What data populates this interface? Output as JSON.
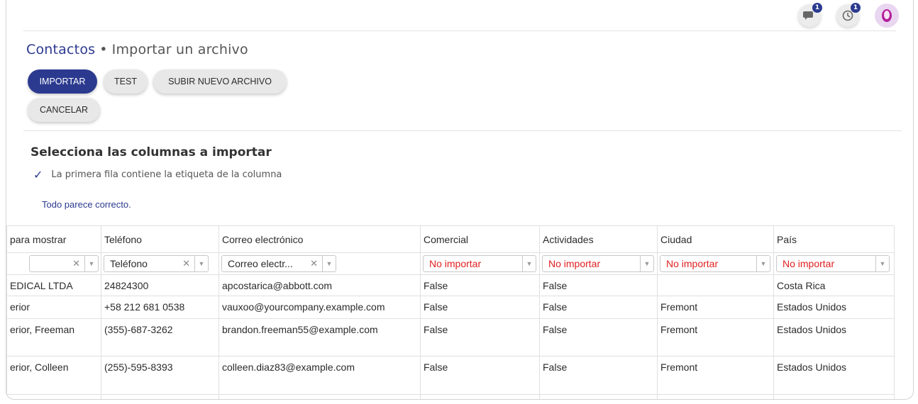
{
  "topbar": {
    "icons": [
      "chat-icon",
      "activity-clock-icon",
      "user-avatar"
    ],
    "badges": [
      "1",
      "1"
    ]
  },
  "breadcrumb": {
    "parent": "Contactos",
    "separator": "•",
    "current": "Importar un archivo"
  },
  "actions": {
    "import": "IMPORTAR",
    "test": "TEST",
    "upload": "SUBIR NUEVO ARCHIVO",
    "cancel": "CANCELAR"
  },
  "section": {
    "title": "Selecciona las columnas a importar",
    "header_checkbox": "La primera fila contiene la etiqueta de la columna",
    "status": "Todo parece correcto."
  },
  "columns": [
    {
      "header": "para mostrar",
      "mapping": ""
    },
    {
      "header": "Teléfono",
      "mapping": "Teléfono"
    },
    {
      "header": "Correo electrónico",
      "mapping": "Correo electr..."
    },
    {
      "header": "Comercial",
      "mapping": "No importar"
    },
    {
      "header": "Actividades",
      "mapping": "No importar"
    },
    {
      "header": "Ciudad",
      "mapping": "No importar"
    },
    {
      "header": "País",
      "mapping": "No importar"
    }
  ],
  "rows": [
    [
      "EDICAL LTDA",
      "24824300",
      "apcostarica@abbott.com",
      "False",
      "False",
      "",
      "Costa Rica"
    ],
    [
      "erior",
      "+58 212 681 0538",
      "vauxoo@yourcompany.example.com",
      "False",
      "False",
      "Fremont",
      "Estados Unidos"
    ],
    [
      "erior, Freeman",
      "(355)-687-3262",
      "brandon.freeman55@example.com",
      "False",
      "False",
      "Fremont",
      "Estados Unidos"
    ],
    [
      "erior, Colleen",
      "(255)-595-8393",
      "colleen.diaz83@example.com",
      "False",
      "False",
      "Fremont",
      "Estados Unidos"
    ]
  ],
  "partial_row": [
    "",
    "(  )",
    "",
    "",
    "",
    "",
    ""
  ],
  "colors": {
    "accent": "#2b3a8f",
    "not_import": "#e02020"
  }
}
